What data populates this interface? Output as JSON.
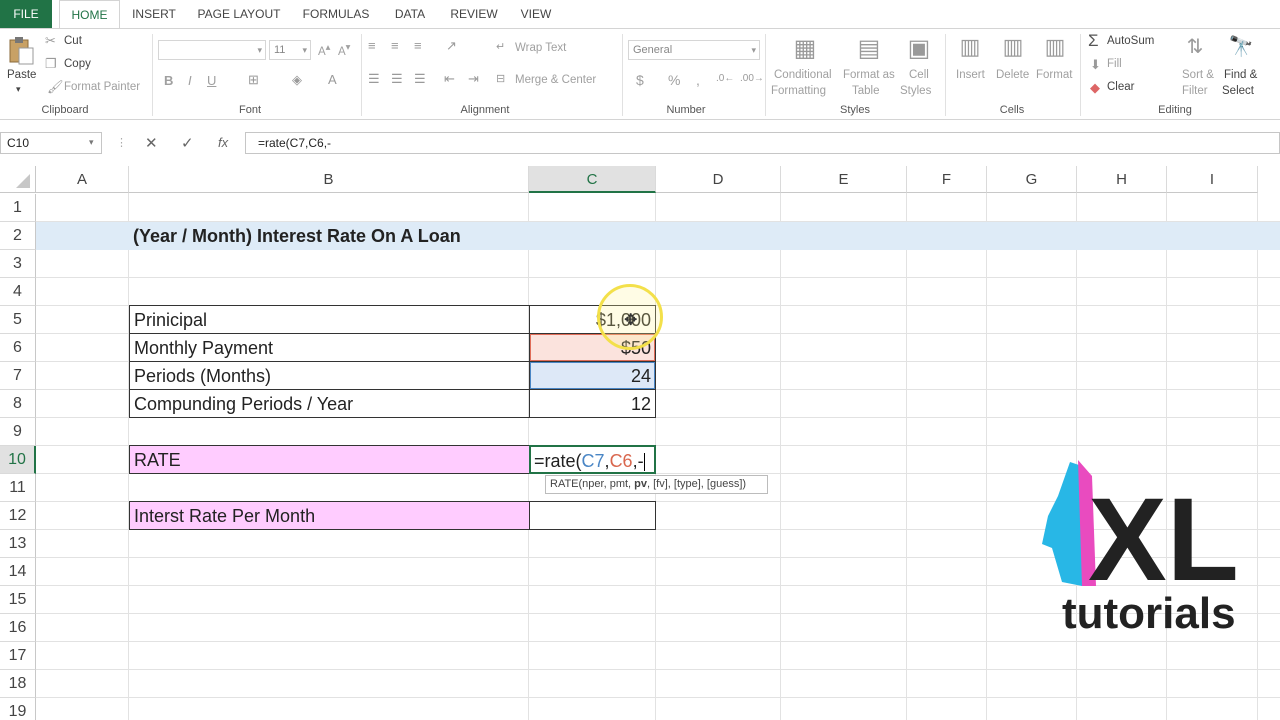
{
  "tabs": {
    "file": "FILE",
    "home": "HOME",
    "insert": "INSERT",
    "page_layout": "PAGE LAYOUT",
    "formulas": "FORMULAS",
    "data": "DATA",
    "review": "REVIEW",
    "view": "VIEW"
  },
  "ribbon": {
    "clipboard": {
      "label": "Clipboard",
      "paste": "Paste",
      "cut": "Cut",
      "copy": "Copy",
      "format_painter": "Format Painter"
    },
    "font": {
      "label": "Font",
      "size": "11",
      "bold": "B",
      "italic": "I",
      "underline": "U"
    },
    "alignment": {
      "label": "Alignment",
      "wrap_text": "Wrap Text",
      "merge_center": "Merge & Center"
    },
    "number": {
      "label": "Number",
      "format": "General",
      "currency": "$",
      "percent": "%",
      "comma": ","
    },
    "styles": {
      "label": "Styles",
      "conditional_line1": "Conditional",
      "conditional_line2": "Formatting",
      "format_table_line1": "Format as",
      "format_table_line2": "Table",
      "cell_styles_line1": "Cell",
      "cell_styles_line2": "Styles"
    },
    "cells": {
      "label": "Cells",
      "insert": "Insert",
      "delete": "Delete",
      "format": "Format"
    },
    "editing": {
      "label": "Editing",
      "autosum": "AutoSum",
      "fill": "Fill",
      "clear": "Clear",
      "sort_line1": "Sort &",
      "sort_line2": "Filter",
      "find_line1": "Find &",
      "find_line2": "Select"
    }
  },
  "formula_bar": {
    "name_box": "C10",
    "formula": "=rate(C7,C6,-",
    "fx": "fx"
  },
  "columns": [
    "A",
    "B",
    "C",
    "D",
    "E",
    "F",
    "G",
    "H",
    "I"
  ],
  "rows": [
    "1",
    "2",
    "3",
    "4",
    "5",
    "6",
    "7",
    "8",
    "9",
    "10",
    "11",
    "12",
    "13",
    "14",
    "15",
    "16",
    "17",
    "18",
    "19"
  ],
  "sheet": {
    "title": "(Year / Month) Interest Rate On A Loan",
    "principal_label": "Prinicipal",
    "principal_value": "$1,000",
    "payment_label": "Monthly Payment",
    "payment_value": "$50",
    "periods_label": "Periods (Months)",
    "periods_value": "24",
    "compounding_label": "Compunding Periods / Year",
    "compounding_value": "12",
    "rate_label": "RATE",
    "rate_formula": {
      "prefix": "=rate(",
      "ref1": "C7",
      "comma1": ",",
      "ref2": "C6",
      "suffix": ",-"
    },
    "interest_label": "Interst Rate Per Month",
    "tooltip": {
      "pre": "RATE(nper, pmt, ",
      "bold": "pv",
      "post": ", [fv], [type], [guess])"
    }
  },
  "logo": {
    "big": "XL",
    "small": "tutorials"
  },
  "colors": {
    "excel_green": "#217346",
    "pink": "#ffccff",
    "title_band": "#deebf7",
    "ref_blue": "#4a86c5",
    "ref_red": "#d9674e"
  }
}
